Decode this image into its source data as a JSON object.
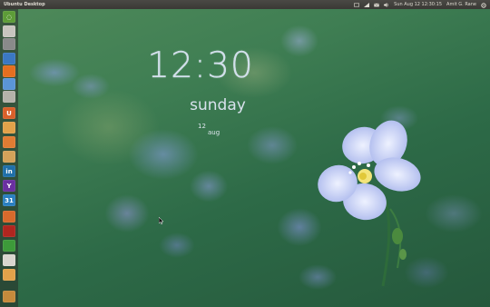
{
  "top_panel": {
    "title": "Ubuntu Desktop",
    "datetime": "Sun Aug 12 12:30:15",
    "user": "Amit G. Rane",
    "indicator_icons": [
      "keyboard-icon",
      "network-icon",
      "mail-icon",
      "speaker-icon",
      "cog-icon"
    ]
  },
  "launcher": {
    "items": [
      {
        "name": "dash-home",
        "icon": "ubuntu-logo-icon",
        "color": "#5d9c38",
        "glyph": "◌"
      },
      {
        "name": "files",
        "icon": "files-icon",
        "color": "#c8c5bf",
        "glyph": ""
      },
      {
        "name": "terminal",
        "icon": "terminal-icon",
        "color": "#8a8a8a",
        "glyph": ""
      },
      {
        "name": "browser",
        "icon": "browser-icon",
        "color": "#3b78c2",
        "glyph": ""
      },
      {
        "name": "firefox",
        "icon": "firefox-icon",
        "color": "#e46f20",
        "glyph": ""
      },
      {
        "name": "chromium",
        "icon": "chromium-icon",
        "color": "#5b95d7",
        "glyph": ""
      },
      {
        "name": "settings",
        "icon": "wrench-icon",
        "color": "#b5b2aa",
        "glyph": ""
      },
      {
        "name": "software-center",
        "icon": "software-center-icon",
        "color": "#d8602a",
        "glyph": "U"
      },
      {
        "name": "home-folder",
        "icon": "folder-icon",
        "color": "#e2a24a",
        "glyph": ""
      },
      {
        "name": "notes",
        "icon": "notes-icon",
        "color": "#e07c33",
        "glyph": ""
      },
      {
        "name": "documents",
        "icon": "document-icon",
        "color": "#d4a25a",
        "glyph": ""
      },
      {
        "name": "linkedin",
        "icon": "linkedin-icon",
        "color": "#1f6fa8",
        "glyph": "in"
      },
      {
        "name": "yahoo",
        "icon": "yahoo-icon",
        "color": "#6a2fa0",
        "glyph": "Y"
      },
      {
        "name": "calendar",
        "icon": "calendar-icon",
        "color": "#2a7fc0",
        "glyph": "31"
      },
      {
        "name": "archive",
        "icon": "archive-icon",
        "color": "#d86a2c",
        "glyph": ""
      },
      {
        "name": "media",
        "icon": "media-icon",
        "color": "#b0261f",
        "glyph": ""
      },
      {
        "name": "messenger",
        "icon": "messenger-icon",
        "color": "#3d9a3a",
        "glyph": ""
      },
      {
        "name": "chat",
        "icon": "chat-icon",
        "color": "#d9d6cf",
        "glyph": ""
      },
      {
        "name": "downloads",
        "icon": "downloads-folder-icon",
        "color": "#e2a24a",
        "glyph": ""
      },
      {
        "name": "trash",
        "icon": "trash-icon",
        "color": "#c58a3c",
        "glyph": ""
      }
    ]
  },
  "clock": {
    "hour": "12",
    "separator": ":",
    "minute": "30",
    "day": "sunday",
    "date_num": "12",
    "date_month": "aug"
  }
}
